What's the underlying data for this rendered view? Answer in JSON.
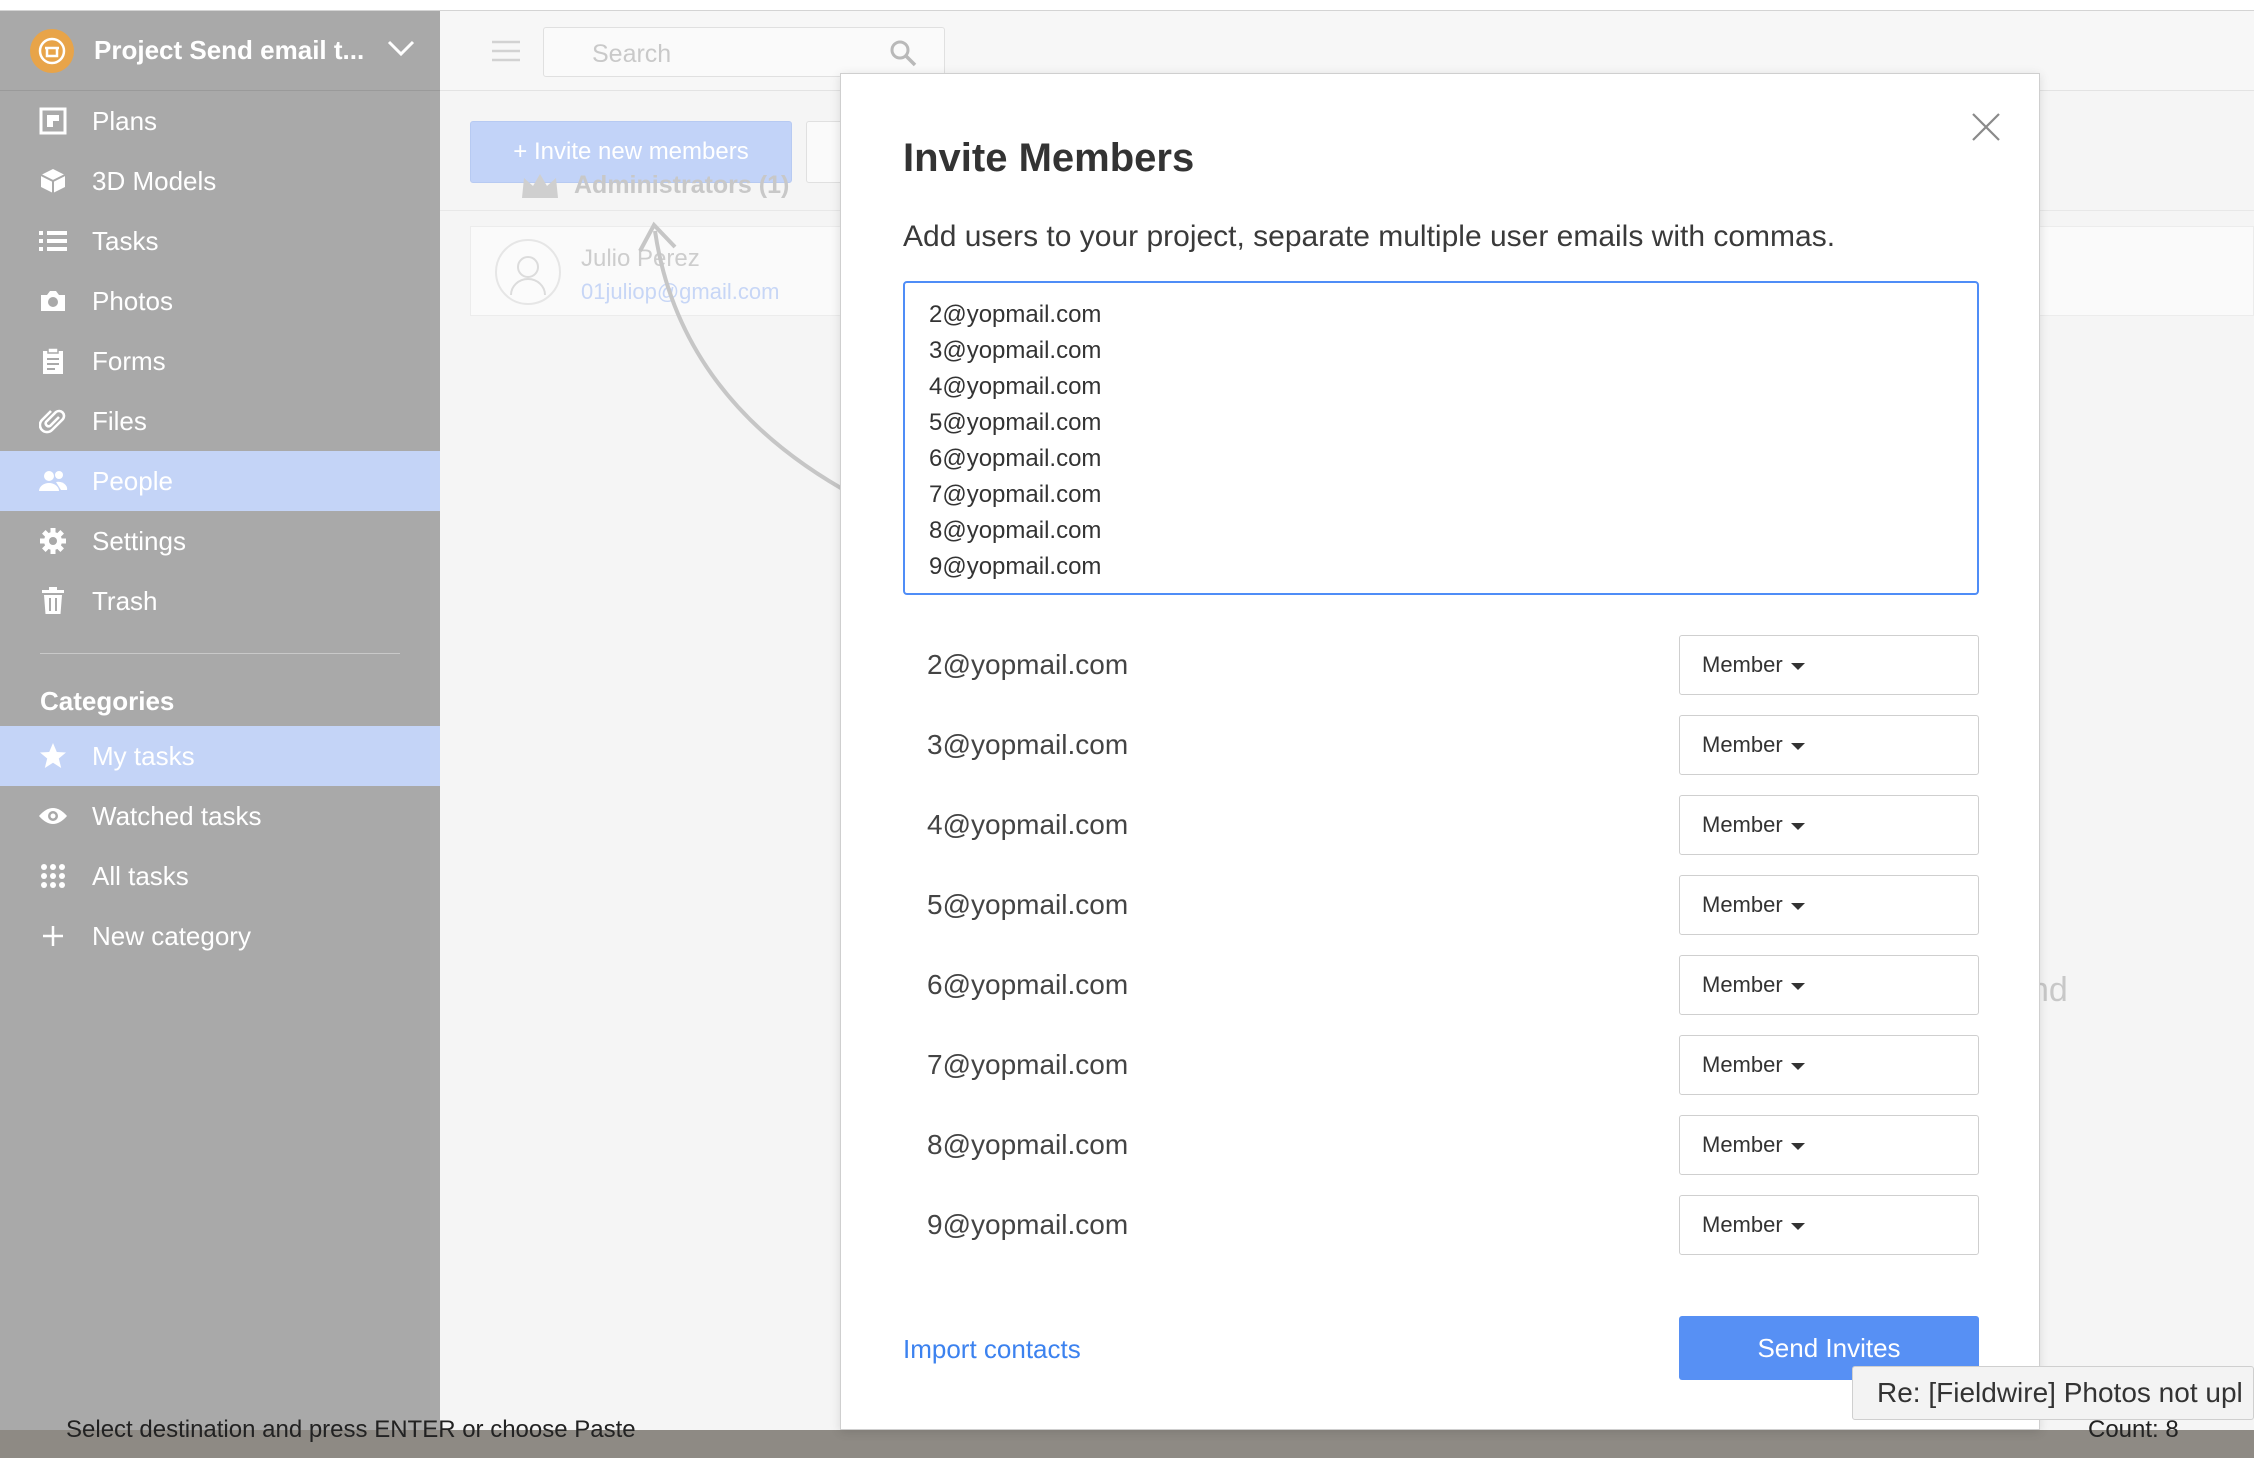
{
  "sidebar": {
    "project_name": "Project Send email t...",
    "nav": [
      {
        "label": "Plans",
        "icon": "plans-icon"
      },
      {
        "label": "3D Models",
        "icon": "cube-icon"
      },
      {
        "label": "Tasks",
        "icon": "list-icon"
      },
      {
        "label": "Photos",
        "icon": "camera-icon"
      },
      {
        "label": "Forms",
        "icon": "clipboard-icon"
      },
      {
        "label": "Files",
        "icon": "paperclip-icon"
      },
      {
        "label": "People",
        "icon": "people-icon",
        "active": true
      },
      {
        "label": "Settings",
        "icon": "gear-icon"
      },
      {
        "label": "Trash",
        "icon": "trash-icon"
      }
    ],
    "categories_title": "Categories",
    "categories": [
      {
        "label": "My tasks",
        "icon": "star-icon",
        "active": true
      },
      {
        "label": "Watched tasks",
        "icon": "eye-icon"
      },
      {
        "label": "All tasks",
        "icon": "grid-icon"
      },
      {
        "label": "New category",
        "icon": "plus-icon"
      }
    ]
  },
  "main": {
    "search_placeholder": "Search",
    "invite_button": "+ Invite new members",
    "admins_label": "Administrators (1)",
    "member_name": "Julio Perez",
    "member_email": "01juliop@gmail.com",
    "partial_text": "nd"
  },
  "modal": {
    "title": "Invite Members",
    "subtitle": "Add users to your project, separate multiple user emails with commas.",
    "textarea_lines": [
      "2@yopmail.com",
      "3@yopmail.com",
      "4@yopmail.com",
      "5@yopmail.com",
      "6@yopmail.com",
      "7@yopmail.com",
      "8@yopmail.com",
      "9@yopmail.com"
    ],
    "invitees": [
      {
        "email": "2@yopmail.com",
        "role": "Member"
      },
      {
        "email": "3@yopmail.com",
        "role": "Member"
      },
      {
        "email": "4@yopmail.com",
        "role": "Member"
      },
      {
        "email": "5@yopmail.com",
        "role": "Member"
      },
      {
        "email": "6@yopmail.com",
        "role": "Member"
      },
      {
        "email": "7@yopmail.com",
        "role": "Member"
      },
      {
        "email": "8@yopmail.com",
        "role": "Member"
      },
      {
        "email": "9@yopmail.com",
        "role": "Member"
      }
    ],
    "import_contacts": "Import contacts",
    "send_button": "Send Invites"
  },
  "tooltip": "Re: [Fieldwire] Photos not upl",
  "statusbar": {
    "left": "Select destination and press ENTER or choose Paste",
    "right": "Count: 8"
  },
  "colors": {
    "sidebar_bg": "#a9a9a9",
    "active_item": "#c4d4f7",
    "primary": "#5790f4",
    "link": "#3c82ef",
    "focus_border": "#4f8df7"
  }
}
